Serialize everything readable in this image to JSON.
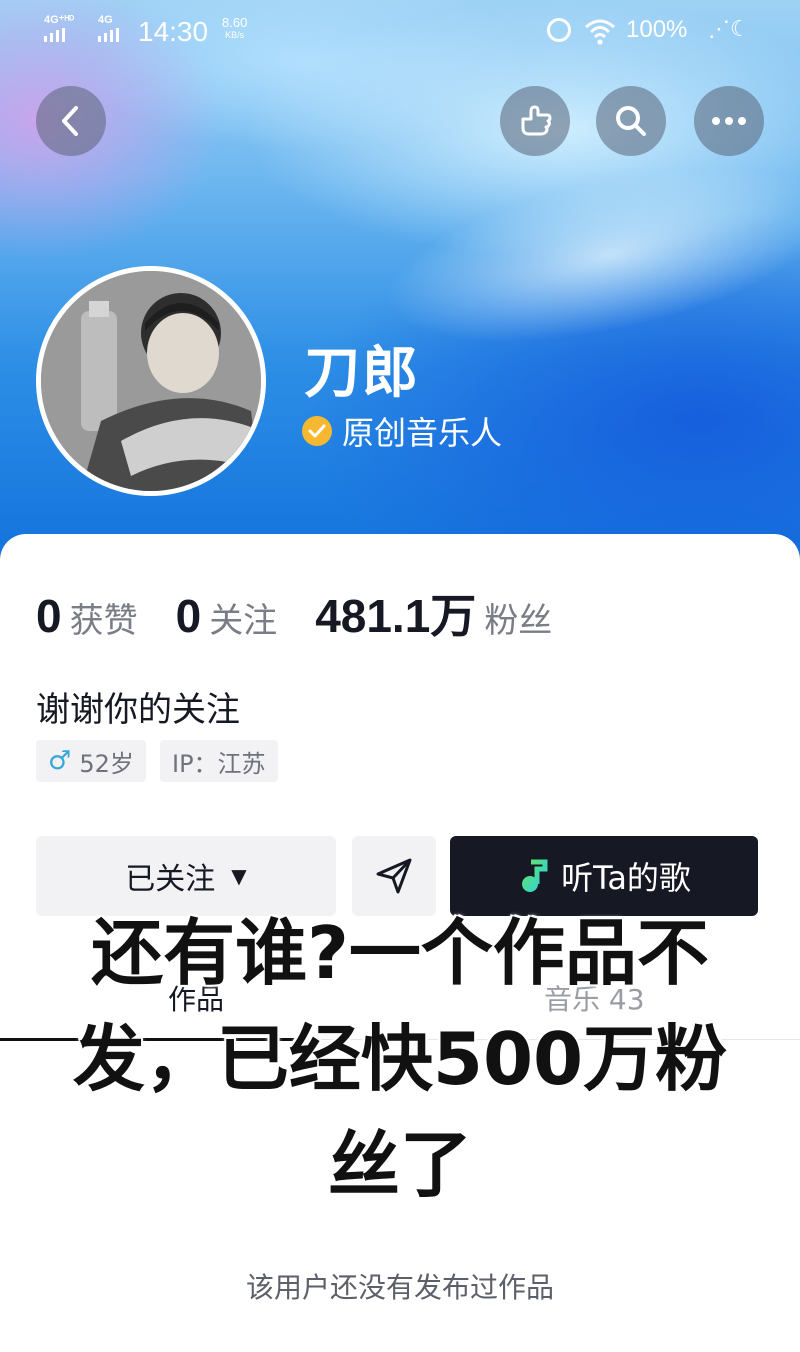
{
  "status_bar": {
    "network1": "4G⁺ᴴᴰ",
    "network2": "4G",
    "time": "14:30",
    "speed_value": "8.60",
    "speed_unit": "KB/s",
    "battery": "100%"
  },
  "header": {
    "back_icon": "chevron-left-icon",
    "actions": [
      "hand-pointer-icon",
      "search-icon",
      "more-icon"
    ]
  },
  "profile": {
    "name": "刀郎",
    "verification_label": "原创音乐人",
    "verification_color": "#f6b731"
  },
  "stats": [
    {
      "value": "0",
      "label": "获赞"
    },
    {
      "value": "0",
      "label": "关注"
    },
    {
      "value": "481.1万",
      "label": "粉丝"
    }
  ],
  "bio": "谢谢你的关注",
  "tags": {
    "age_symbol": "♂",
    "age": "52岁",
    "ip": "IP：江苏"
  },
  "buttons": {
    "follow": "已关注",
    "follow_caret": "▼",
    "listen": "听Ta的歌"
  },
  "tabs": {
    "works": "作品",
    "music": "音乐 43"
  },
  "overlay_caption": "还有谁?一个作品不发，已经快500万粉丝了",
  "empty_state": "该用户还没有发布过作品",
  "colors": {
    "accent_dark": "#161823",
    "hero_blue": "#1170dc",
    "male_icon": "#35a7d9"
  }
}
